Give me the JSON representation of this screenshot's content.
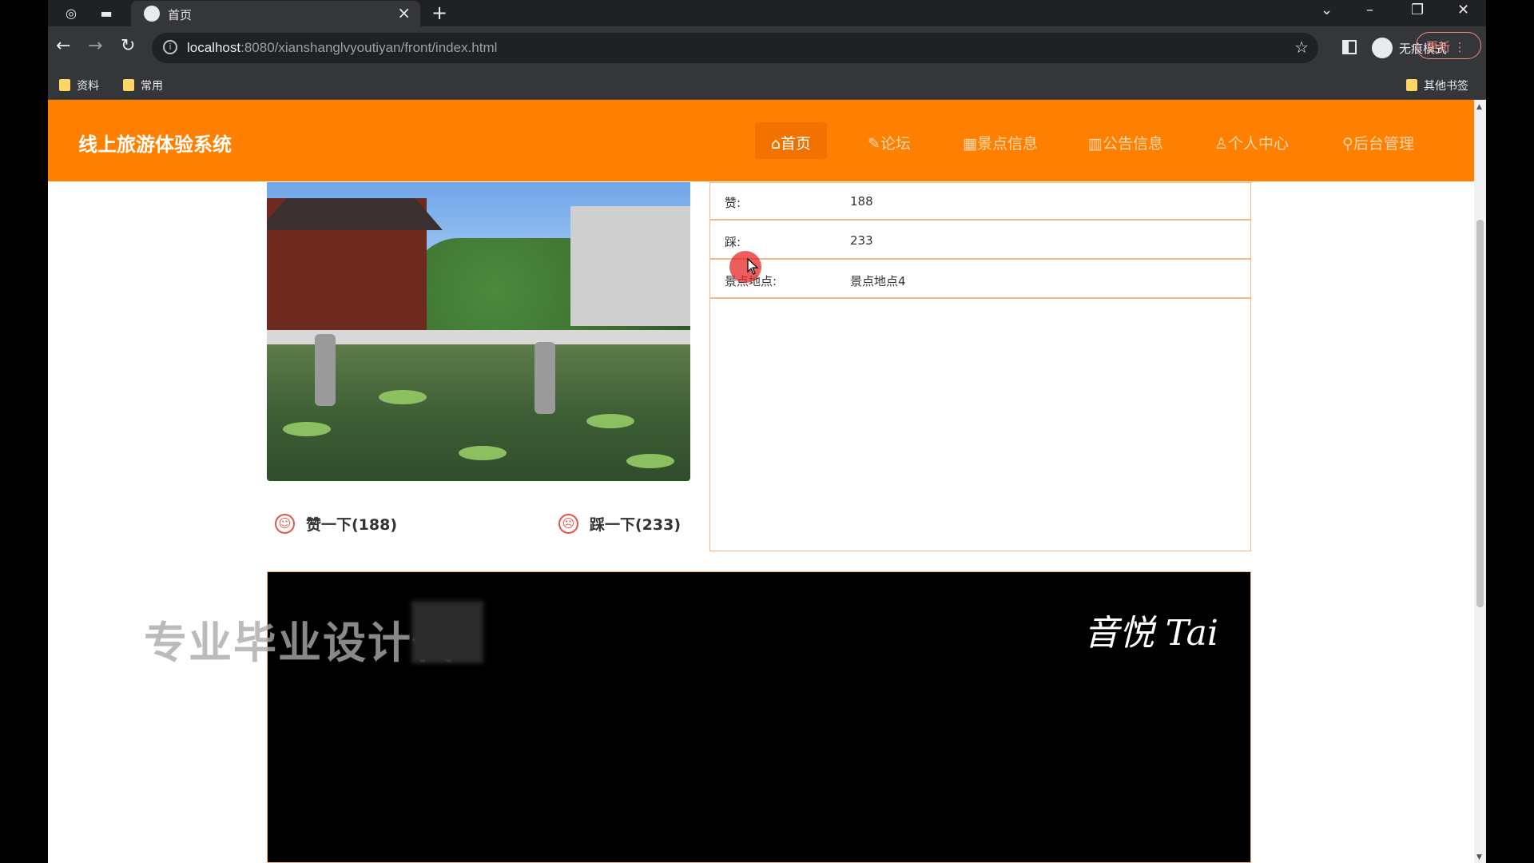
{
  "browser": {
    "tab_title": "首页",
    "url_host": "localhost",
    "url_rest": ":8080/xianshanglvyoutiyan/front/index.html",
    "incognito_label": "无痕模式",
    "update_label": "更新 ⋮",
    "bookmarks": [
      "资料",
      "常用"
    ],
    "other_bookmarks": "其他书签"
  },
  "site": {
    "title": "线上旅游体验系统",
    "menu": [
      {
        "label": "⌂首页",
        "icon": "home-icon"
      },
      {
        "label": "✎论坛",
        "icon": "forum-icon"
      },
      {
        "label": "▦景点信息",
        "icon": "scenic-icon"
      },
      {
        "label": "▥公告信息",
        "icon": "notice-icon"
      },
      {
        "label": "♙个人中心",
        "icon": "user-icon"
      },
      {
        "label": "⚲后台管理",
        "icon": "admin-icon"
      }
    ]
  },
  "detail": {
    "like_label": "赞一下(188)",
    "dislike_label": "踩一下(233)",
    "rows": [
      {
        "key": "赞:",
        "value": "188"
      },
      {
        "key": "踩:",
        "value": "233"
      },
      {
        "key": "景点地点:",
        "value": "景点地点4"
      }
    ]
  },
  "video": {
    "signature": "音悦 Tai"
  },
  "overlay": {
    "watermark": "专业毕业设计代"
  }
}
